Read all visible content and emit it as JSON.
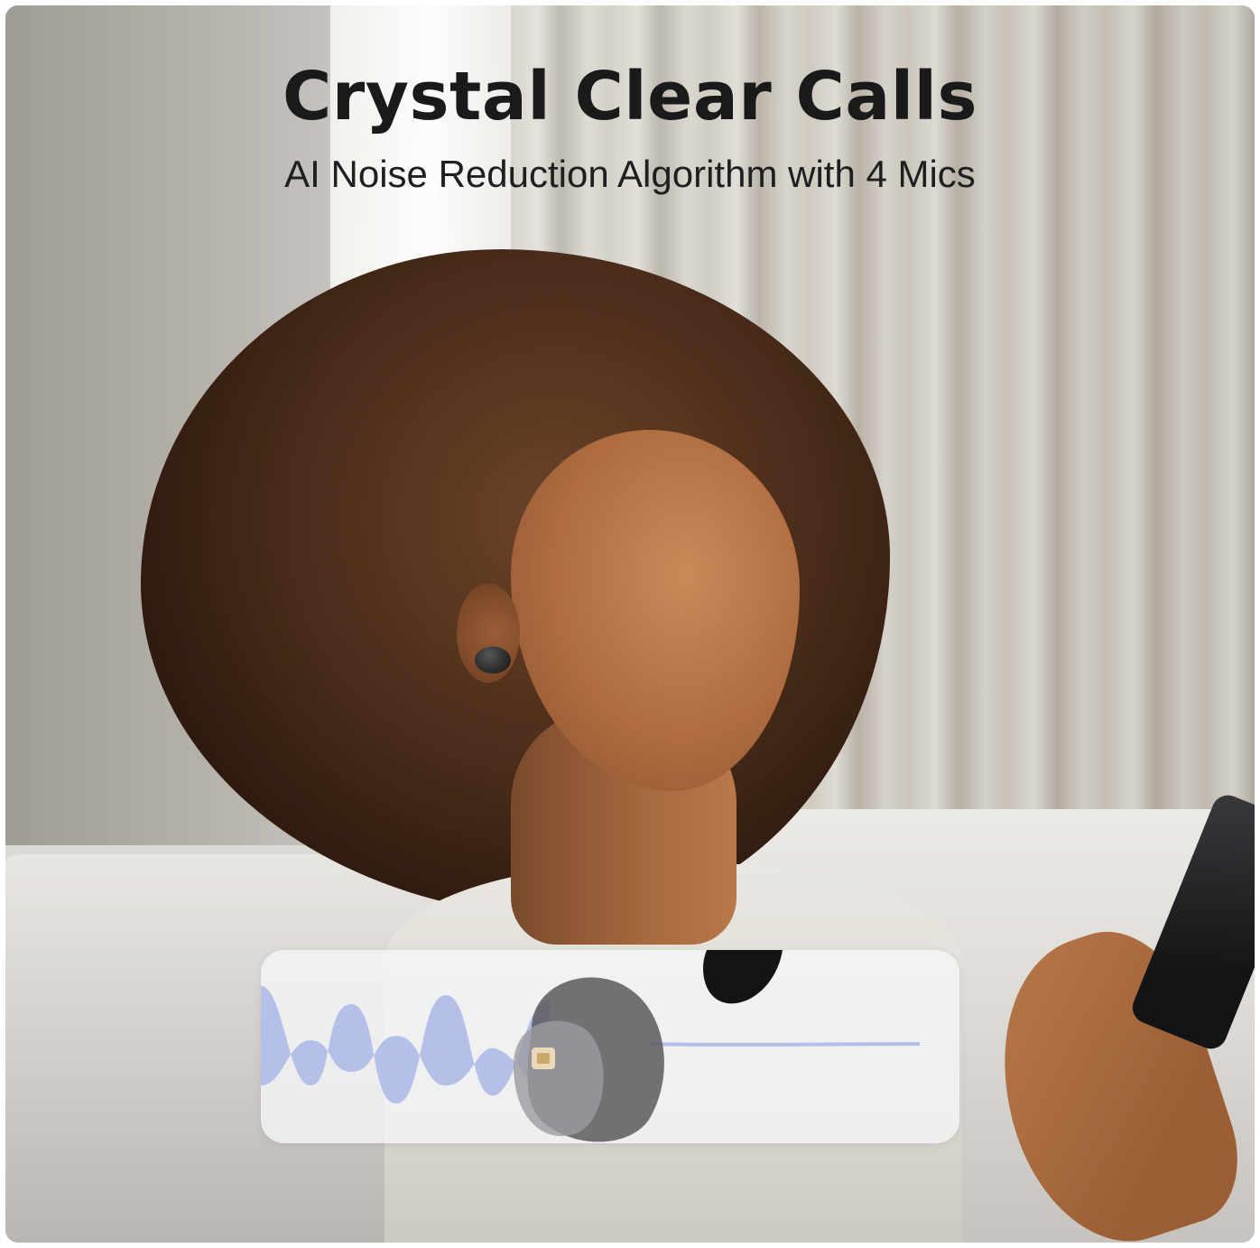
{
  "headline": {
    "title": "Crystal Clear Calls",
    "subtitle": "AI Noise Reduction Algorithm with 4 Mics"
  },
  "colors": {
    "title_text": "#1a1a1a",
    "waveform": "#a9b7e6",
    "earbud": "#141416"
  }
}
